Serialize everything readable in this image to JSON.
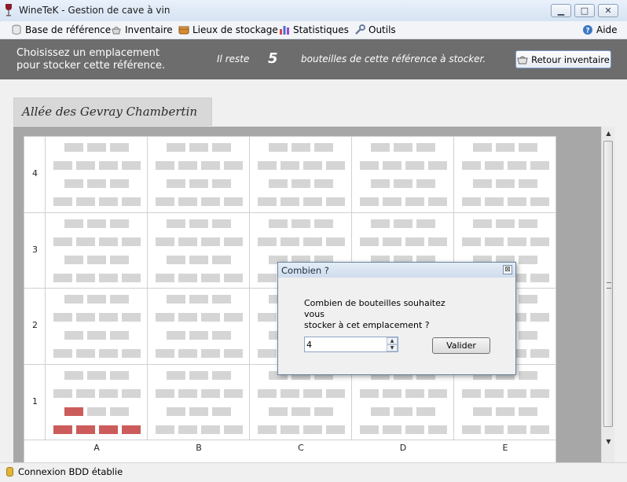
{
  "window": {
    "title": "WineTeK - Gestion de cave à vin",
    "minimize_label": "▁",
    "maximize_label": "□",
    "close_label": "✕"
  },
  "menu": {
    "items": [
      {
        "label": "Base de référence",
        "icon": "database-icon"
      },
      {
        "label": "Inventaire",
        "icon": "basket-icon"
      },
      {
        "label": "Lieux de stockage",
        "icon": "crate-icon"
      },
      {
        "label": "Statistiques",
        "icon": "bar-chart-icon"
      },
      {
        "label": "Outils",
        "icon": "wrench-icon"
      }
    ],
    "help": {
      "label": "Aide",
      "icon": "help-icon"
    }
  },
  "header": {
    "prompt_line1": "Choisissez un emplacement",
    "prompt_line2": "pour stocker cette référence.",
    "reste": "Il reste",
    "count": "5",
    "suffix": "bouteilles de cette référence à stocker.",
    "retour_label": "Retour inventaire"
  },
  "allee": {
    "title": "Allée des Gevray Chambertin"
  },
  "rack": {
    "rows": [
      "4",
      "3",
      "2",
      "1"
    ],
    "columns": [
      "A",
      "B",
      "C",
      "D",
      "E"
    ],
    "occupied": {
      "A1": {
        "row2": [
          1,
          0,
          0
        ],
        "row1": [
          1,
          1,
          1,
          1
        ]
      }
    }
  },
  "dialog": {
    "title": "Combien ?",
    "close_label": "⊠",
    "question_line1": "Combien de bouteilles souhaitez vous",
    "question_line2": "stocker à cet emplacement ?",
    "value": "4",
    "valider_label": "Valider"
  },
  "status": {
    "text": "Connexion BDD établie"
  },
  "colors": {
    "header_bg": "#6d6d6d",
    "bottle_empty": "#d5d5d5",
    "bottle_full": "#cc5c5c"
  }
}
